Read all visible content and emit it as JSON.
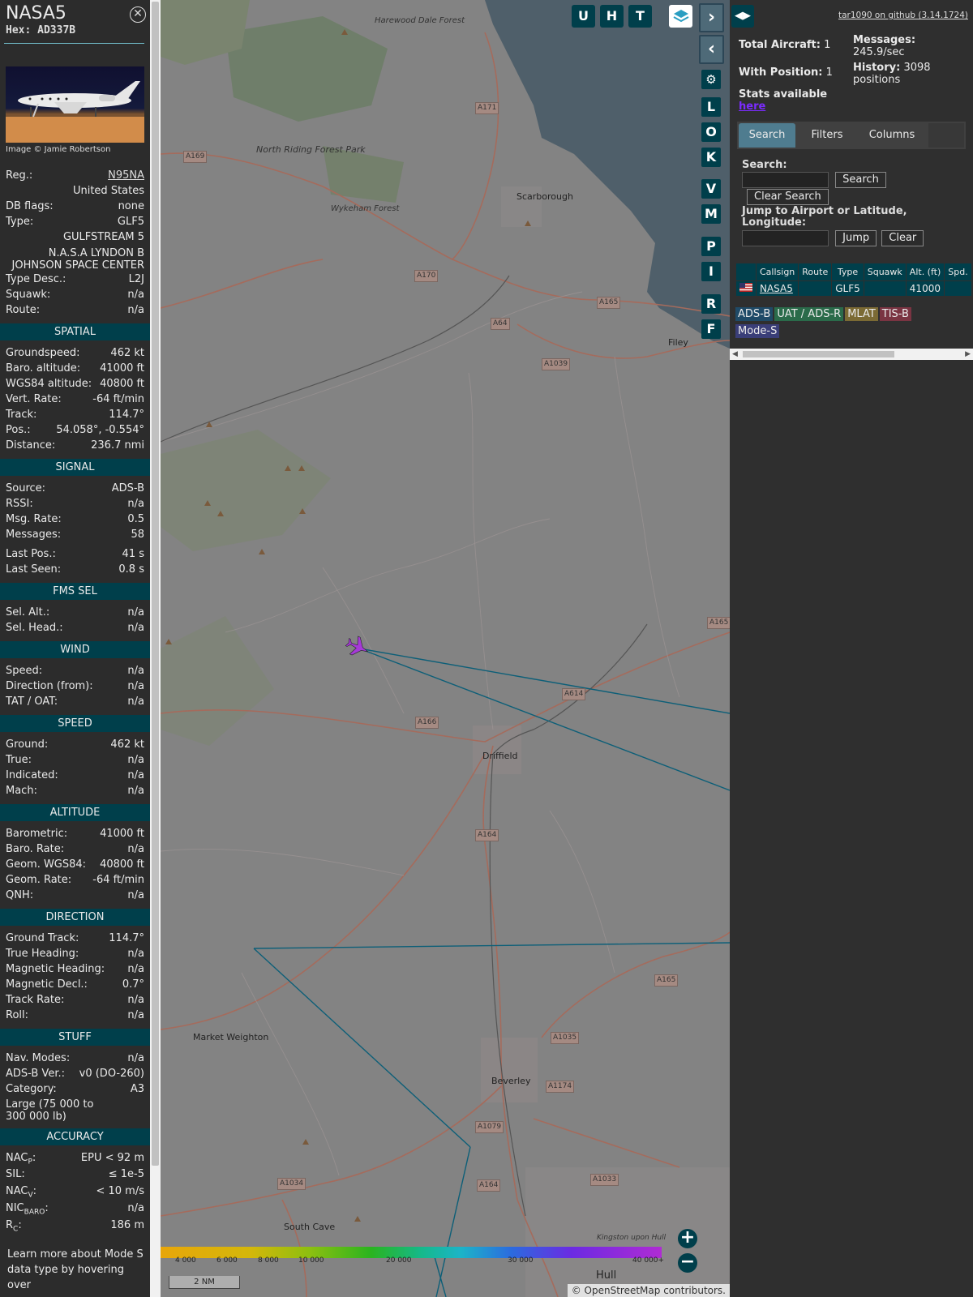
{
  "info": {
    "callsign": "NASA5",
    "hex_label": "Hex:",
    "hex": "AD337B",
    "photo_credit": "Image © Jamie Robertson",
    "reg_label": "Reg.:",
    "reg": "N95NA",
    "country": "United States",
    "dbflags_label": "DB flags:",
    "dbflags": "none",
    "type_label": "Type:",
    "type": "GLF5",
    "type_full": "GULFSTREAM 5",
    "owner": "N.A.S.A LYNDON B JOHNSON SPACE CENTER",
    "typedesc_label": "Type Desc.:",
    "typedesc": "L2J",
    "squawk_label": "Squawk:",
    "squawk": "n/a",
    "route_label": "Route:",
    "route": "n/a",
    "learn_more": "Learn more about Mode S data type by hovering over"
  },
  "sections": [
    {
      "title": "SPATIAL",
      "rows": [
        [
          "Groundspeed:",
          "462 kt"
        ],
        [
          "Baro. altitude:",
          "41000 ft"
        ],
        [
          "WGS84 altitude:",
          "40800 ft"
        ],
        [
          "Vert. Rate:",
          "-64 ft/min"
        ],
        [
          "Track:",
          "114.7°"
        ],
        [
          "Pos.:",
          "54.058°, -0.554°"
        ],
        [
          "Distance:",
          "236.7 nmi"
        ]
      ]
    },
    {
      "title": "SIGNAL",
      "rows": [
        [
          "Source:",
          "ADS-B"
        ],
        [
          "RSSI:",
          "n/a"
        ],
        [
          "Msg. Rate:",
          "0.5"
        ],
        [
          "Messages:",
          "58"
        ]
      ],
      "rows2": [
        [
          "Last Pos.:",
          "41 s"
        ],
        [
          "Last Seen:",
          "0.8 s"
        ]
      ]
    },
    {
      "title": "FMS SEL",
      "rows": [
        [
          "Sel. Alt.:",
          "n/a"
        ],
        [
          "Sel. Head.:",
          "n/a"
        ]
      ]
    },
    {
      "title": "WIND",
      "rows": [
        [
          "Speed:",
          "n/a"
        ],
        [
          "Direction (from):",
          "n/a"
        ],
        [
          "TAT / OAT:",
          "n/a"
        ]
      ]
    },
    {
      "title": "SPEED",
      "rows": [
        [
          "Ground:",
          "462 kt"
        ],
        [
          "True:",
          "n/a"
        ],
        [
          "Indicated:",
          "n/a"
        ],
        [
          "Mach:",
          "n/a"
        ]
      ]
    },
    {
      "title": "ALTITUDE",
      "rows": [
        [
          "Barometric:",
          "41000 ft"
        ],
        [
          "Baro. Rate:",
          "n/a"
        ],
        [
          "Geom. WGS84:",
          "40800 ft"
        ],
        [
          "Geom. Rate:",
          "-64 ft/min"
        ],
        [
          "QNH:",
          "n/a"
        ]
      ]
    },
    {
      "title": "DIRECTION",
      "rows": [
        [
          "Ground Track:",
          "114.7°"
        ],
        [
          "True Heading:",
          "n/a"
        ],
        [
          "Magnetic Heading:",
          "n/a"
        ],
        [
          "Magnetic Decl.:",
          "0.7°"
        ],
        [
          "Track Rate:",
          "n/a"
        ],
        [
          "Roll:",
          "n/a"
        ]
      ]
    },
    {
      "title": "STUFF",
      "rows": [
        [
          "Nav. Modes:",
          "n/a"
        ],
        [
          "ADS-B Ver.:",
          "v0 (DO-260)"
        ],
        [
          "Category:",
          "A3"
        ]
      ],
      "note": "Large (75 000 to 300 000 lb)"
    },
    {
      "title": "ACCURACY"
    }
  ],
  "accuracy": {
    "nacp_label": "NAC",
    "nacp_sub": "P",
    "nacp": "EPU < 92 m",
    "sil_label": "SIL:",
    "sil": "≤ 1e-5",
    "nacv_label": "NAC",
    "nacv_sub": "V",
    "nacv": "< 10 m/s",
    "nic_label": "NIC",
    "nic_sub": "BARO",
    "nic": "n/a",
    "rc_label": "R",
    "rc_sub": "C",
    "rc": "186 m"
  },
  "map": {
    "top_buttons": [
      "U",
      "H",
      "T"
    ],
    "side_buttons": [
      "L",
      "O",
      "K",
      "V",
      "M",
      "P",
      "I",
      "R",
      "F"
    ],
    "labels": {
      "harewood": "Harewood Dale Forest",
      "nrfp": "North Riding Forest Park",
      "wykeham": "Wykeham Forest",
      "scarborough": "Scarborough",
      "filey": "Filey",
      "driffield": "Driffield",
      "market_weighton": "Market Weighton",
      "beverley": "Beverley",
      "south_cave": "South Cave",
      "hull": "Hull",
      "kingston": "Kingston upon Hull"
    },
    "roads": [
      "A171",
      "A169",
      "A170",
      "A165",
      "A64",
      "A1039",
      "A165",
      "A614",
      "A166",
      "A164",
      "A165",
      "A1035",
      "A1079",
      "A1174",
      "A1034",
      "A164",
      "A1033"
    ],
    "altitude_ticks": [
      "4 000",
      "6 000",
      "8 000",
      "10 000",
      "20 000",
      "30 000",
      "40 000+"
    ],
    "scale": "2 NM",
    "attribution_prefix": "© ",
    "attribution_link": "OpenStreetMap",
    "attribution_suffix": " contributors.",
    "zoom_in": "+",
    "zoom_out": "−"
  },
  "sidebar": {
    "version": "tar1090 on github (3.14.1724)",
    "total_aircraft_label": "Total Aircraft:",
    "total_aircraft": "1",
    "with_position_label": "With Position:",
    "with_position": "1",
    "messages_label": "Messages:",
    "messages": "245.9/sec",
    "history_label": "History:",
    "history": "3098 positions",
    "stats_label": "Stats available",
    "stats_link": "here",
    "tabs": [
      "Search",
      "Filters",
      "Columns"
    ],
    "search_label": "Search:",
    "search_button": "Search",
    "clear_search_button": "Clear Search",
    "jump_label": "Jump to Airport or Latitude, Longitude:",
    "jump_button": "Jump",
    "clear_button": "Clear",
    "table_headers": [
      "",
      "Callsign",
      "Route",
      "Type",
      "Squawk",
      "Alt. (ft)",
      "Spd."
    ],
    "table_row": {
      "callsign": "NASA5",
      "route": "",
      "type": "GLF5",
      "squawk": "",
      "alt": "41000",
      "spd": ""
    },
    "legend": [
      "ADS-B",
      "UAT / ADS-R",
      "MLAT",
      "TIS-B",
      "Mode-S"
    ]
  },
  "colors": {
    "panel_bg": "#2c2c2c",
    "section_bg": "#003f4b",
    "map_bg": "#838383",
    "track_line": "#0d5f78",
    "aircraft": "#a63ad8",
    "legend_adsb": "#1f4a67",
    "legend_uat": "#2a6b4a",
    "legend_mlat": "#7b6a34",
    "legend_tisb": "#7a3442",
    "legend_modes": "#3a3e78"
  }
}
